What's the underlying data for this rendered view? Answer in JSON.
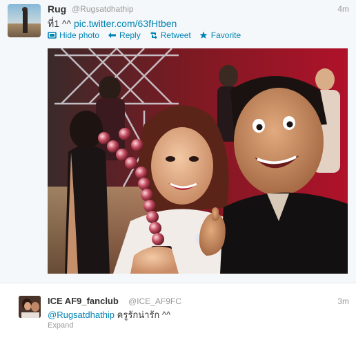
{
  "main_tweet": {
    "name": "Rug",
    "handle": "@Rugsatdhathip",
    "time": "4m",
    "text_prefix": "ที่1 ^^",
    "link": "pic.twitter.com/63fHtben",
    "actions": {
      "hide_photo": "Hide photo",
      "reply": "Reply",
      "retweet": "Retweet",
      "favorite": "Favorite"
    }
  },
  "reply_tweet": {
    "name": "ICE AF9_fanclub",
    "handle": "@ICE_AF9FC",
    "time": "3m",
    "mention": "@Rugsatdhathip",
    "text": "ครูรักน่ารัก ^^",
    "expand": "Expand"
  },
  "colors": {
    "link": "#0084b4",
    "muted": "#999999",
    "text": "#333333"
  },
  "icons": [
    "photo-icon",
    "reply-icon",
    "retweet-icon",
    "star-icon"
  ]
}
